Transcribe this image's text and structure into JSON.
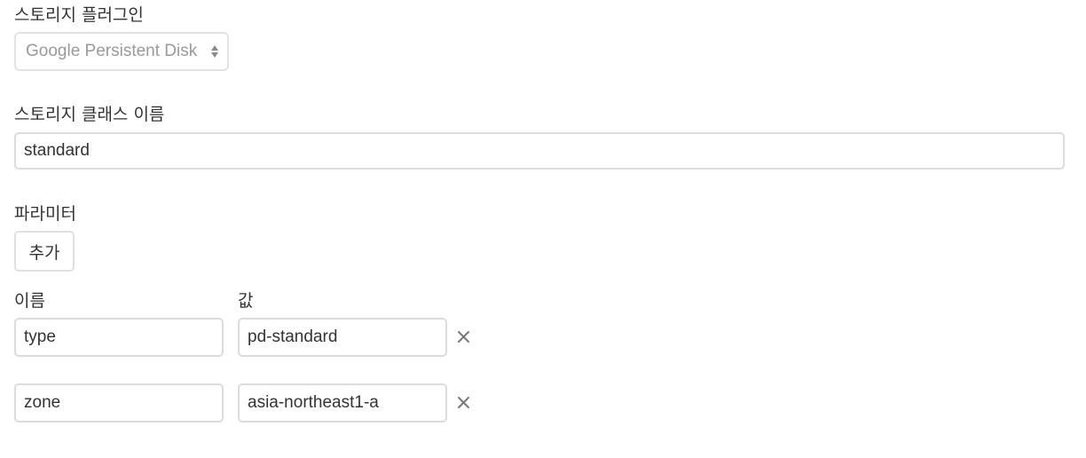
{
  "storage_plugin": {
    "label": "스토리지 플러그인",
    "selected": "Google Persistent Disk"
  },
  "storage_class": {
    "label": "스토리지 클래스 이름",
    "value": "standard"
  },
  "parameters": {
    "label": "파라미터",
    "add_label": "추가",
    "name_header": "이름",
    "value_header": "값",
    "rows": [
      {
        "name": "type",
        "value": "pd-standard"
      },
      {
        "name": "zone",
        "value": "asia-northeast1-a"
      }
    ]
  },
  "icons": {
    "select_arrows": "sort-arrows-icon",
    "remove": "close-icon"
  },
  "colors": {
    "border": "#dcdcdc",
    "text": "#333333",
    "muted_text": "#9a9a9a",
    "icon": "#777777"
  }
}
